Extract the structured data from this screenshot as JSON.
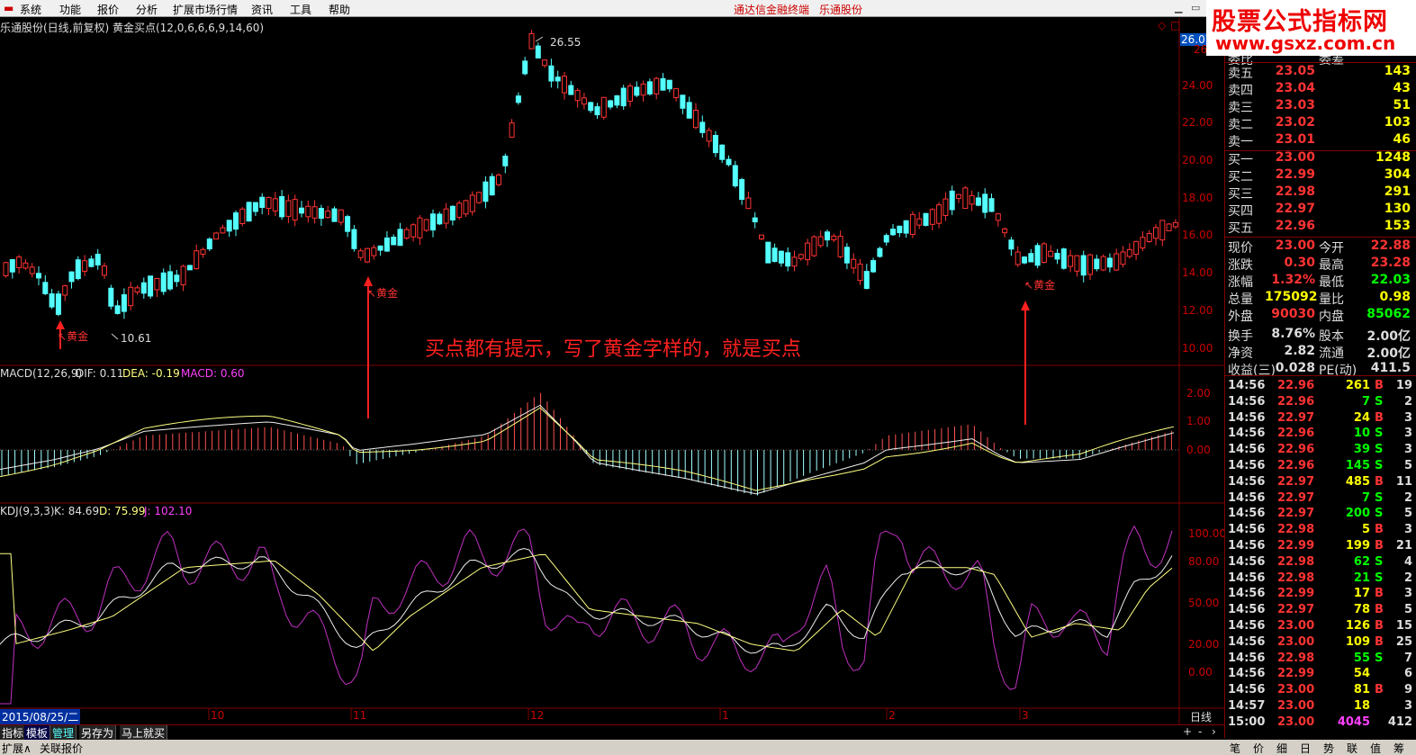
{
  "menu": {
    "items": [
      "系统",
      "功能",
      "报价",
      "分析",
      "扩展市场行情",
      "资讯",
      "工具",
      "帮助"
    ],
    "center_title": "通达信金融终端",
    "stock_name": "乐通股份"
  },
  "logo": {
    "line1": "股票公式指标网",
    "line2": "www.gsxz.com.cn"
  },
  "main_chart": {
    "header": "乐通股份(日线,前复权) 黄金买点(12,0,6,6,6,9,14,60)",
    "price_axis": [
      "26.07",
      "26",
      "24.00",
      "22.00",
      "20.00",
      "18.00",
      "16.00",
      "14.00",
      "12.00",
      "10.00"
    ],
    "high_label": "26.55",
    "low_label": "10.61",
    "signals": [
      "黄金",
      "黄金",
      "黄金"
    ],
    "annotation": "买点都有提示，写了黄金字样的，就是买点",
    "colors": {
      "up": "#ff3333",
      "down": "#54ffff",
      "signal": "#ff3333"
    }
  },
  "macd": {
    "header_name": "MACD(12,26,9)",
    "dif": "DIF: 0.11",
    "dea": "DEA: -0.19",
    "macd": "MACD: 0.60",
    "axis": [
      "2.00",
      "1.00",
      "0.00"
    ]
  },
  "kdj": {
    "header_name": "KDJ(9,3,3)",
    "k": "K: 84.69",
    "d": "D: 75.99",
    "j": "J: 102.10",
    "axis": [
      "100.00",
      "80.00",
      "50.00",
      "20.00",
      "0.00"
    ]
  },
  "date_axis": {
    "current_date": "2015/08/25/二",
    "months": [
      "10",
      "11",
      "12",
      "1",
      "2",
      "3"
    ],
    "period": "日线"
  },
  "order_book": {
    "partial_top": [
      "委比",
      "委差"
    ],
    "asks": [
      {
        "label": "卖五",
        "price": "23.05",
        "vol": "143"
      },
      {
        "label": "卖四",
        "price": "23.04",
        "vol": "43"
      },
      {
        "label": "卖三",
        "price": "23.03",
        "vol": "51"
      },
      {
        "label": "卖二",
        "price": "23.02",
        "vol": "103"
      },
      {
        "label": "卖一",
        "price": "23.01",
        "vol": "46"
      }
    ],
    "bids": [
      {
        "label": "买一",
        "price": "23.00",
        "vol": "1248"
      },
      {
        "label": "买二",
        "price": "22.99",
        "vol": "304"
      },
      {
        "label": "买三",
        "price": "22.98",
        "vol": "291"
      },
      {
        "label": "买四",
        "price": "22.97",
        "vol": "130"
      },
      {
        "label": "买五",
        "price": "22.96",
        "vol": "153"
      }
    ]
  },
  "stats": [
    {
      "l1": "现价",
      "v1": "23.00",
      "c1": "#ff3333",
      "l2": "今开",
      "v2": "22.88",
      "c2": "#ff3333"
    },
    {
      "l1": "涨跌",
      "v1": "0.30",
      "c1": "#ff3333",
      "l2": "最高",
      "v2": "23.28",
      "c2": "#ff3333"
    },
    {
      "l1": "涨幅",
      "v1": "1.32%",
      "c1": "#ff3333",
      "l2": "最低",
      "v2": "22.03",
      "c2": "#00ff00"
    },
    {
      "l1": "总量",
      "v1": "175092",
      "c1": "#ffff00",
      "l2": "量比",
      "v2": "0.98",
      "c2": "#ffff00"
    },
    {
      "l1": "外盘",
      "v1": "90030",
      "c1": "#ff3333",
      "l2": "内盘",
      "v2": "85062",
      "c2": "#00ff00"
    },
    {
      "l1": "换手",
      "v1": "8.76%",
      "c1": "#dddddd",
      "l2": "股本",
      "v2": "2.00亿",
      "c2": "#dddddd"
    },
    {
      "l1": "净资",
      "v1": "2.82",
      "c1": "#dddddd",
      "l2": "流通",
      "v2": "2.00亿",
      "c2": "#dddddd"
    },
    {
      "l1": "收益(三)",
      "v1": "0.028",
      "c1": "#dddddd",
      "l2": "PE(动)",
      "v2": "411.5",
      "c2": "#dddddd"
    }
  ],
  "ticks": [
    {
      "t": "14:56",
      "p": "22.96",
      "v": "261",
      "bs": "B",
      "n": "19"
    },
    {
      "t": "14:56",
      "p": "22.96",
      "v": "7",
      "bs": "S",
      "n": "2"
    },
    {
      "t": "14:56",
      "p": "22.97",
      "v": "24",
      "bs": "B",
      "n": "3"
    },
    {
      "t": "14:56",
      "p": "22.96",
      "v": "10",
      "bs": "S",
      "n": "3"
    },
    {
      "t": "14:56",
      "p": "22.96",
      "v": "39",
      "bs": "S",
      "n": "3"
    },
    {
      "t": "14:56",
      "p": "22.96",
      "v": "145",
      "bs": "S",
      "n": "5"
    },
    {
      "t": "14:56",
      "p": "22.97",
      "v": "485",
      "bs": "B",
      "n": "11"
    },
    {
      "t": "14:56",
      "p": "22.97",
      "v": "7",
      "bs": "S",
      "n": "2"
    },
    {
      "t": "14:56",
      "p": "22.97",
      "v": "200",
      "bs": "S",
      "n": "5"
    },
    {
      "t": "14:56",
      "p": "22.98",
      "v": "5",
      "bs": "B",
      "n": "3"
    },
    {
      "t": "14:56",
      "p": "22.99",
      "v": "199",
      "bs": "B",
      "n": "21"
    },
    {
      "t": "14:56",
      "p": "22.98",
      "v": "62",
      "bs": "S",
      "n": "4"
    },
    {
      "t": "14:56",
      "p": "22.98",
      "v": "21",
      "bs": "S",
      "n": "2"
    },
    {
      "t": "14:56",
      "p": "22.99",
      "v": "17",
      "bs": "B",
      "n": "3"
    },
    {
      "t": "14:56",
      "p": "22.97",
      "v": "78",
      "bs": "B",
      "n": "5"
    },
    {
      "t": "14:56",
      "p": "23.00",
      "v": "126",
      "bs": "B",
      "n": "15"
    },
    {
      "t": "14:56",
      "p": "23.00",
      "v": "109",
      "bs": "B",
      "n": "25"
    },
    {
      "t": "14:56",
      "p": "22.98",
      "v": "55",
      "bs": "S",
      "n": "7"
    },
    {
      "t": "14:56",
      "p": "22.99",
      "v": "54",
      "bs": "",
      "n": "6"
    },
    {
      "t": "14:56",
      "p": "23.00",
      "v": "81",
      "bs": "B",
      "n": "9"
    },
    {
      "t": "14:57",
      "p": "23.00",
      "v": "18",
      "bs": "",
      "n": "3"
    },
    {
      "t": "15:00",
      "p": "23.00",
      "v": "4045",
      "bs": "",
      "n": "412"
    }
  ],
  "bottom_tabs": [
    "指标",
    "模板",
    "管理",
    "另存为",
    "马上就买"
  ],
  "status": [
    "扩展∧",
    "关联报价"
  ],
  "quote_tabs": [
    "笔",
    "价",
    "细",
    "日",
    "势",
    "联",
    "值",
    "筹"
  ]
}
